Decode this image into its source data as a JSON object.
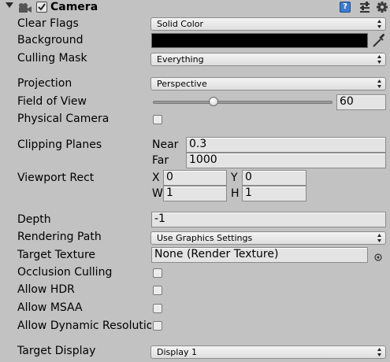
{
  "header": {
    "title": "Camera",
    "enabled": true,
    "help_glyph": "?",
    "icons": [
      "foldout-arrow-icon",
      "camera-component-icon",
      "help-icon",
      "preset-icon",
      "gear-icon"
    ]
  },
  "fields": {
    "clear_flags": {
      "label": "Clear Flags",
      "value": "Solid Color"
    },
    "background": {
      "label": "Background",
      "color": "#000000"
    },
    "culling_mask": {
      "label": "Culling Mask",
      "value": "Everything"
    },
    "projection": {
      "label": "Projection",
      "value": "Perspective"
    },
    "field_of_view": {
      "label": "Field of View",
      "value": "60"
    },
    "physical_camera": {
      "label": "Physical Camera",
      "checked": false
    },
    "clipping_planes": {
      "label": "Clipping Planes",
      "near_label": "Near",
      "near": "0.3",
      "far_label": "Far",
      "far": "1000"
    },
    "viewport_rect": {
      "label": "Viewport Rect",
      "x_label": "X",
      "x": "0",
      "y_label": "Y",
      "y": "0",
      "w_label": "W",
      "w": "1",
      "h_label": "H",
      "h": "1"
    },
    "depth": {
      "label": "Depth",
      "value": "-1"
    },
    "rendering_path": {
      "label": "Rendering Path",
      "value": "Use Graphics Settings"
    },
    "target_texture": {
      "label": "Target Texture",
      "value": "None (Render Texture)"
    },
    "occlusion_culling": {
      "label": "Occlusion Culling",
      "checked": false
    },
    "allow_hdr": {
      "label": "Allow HDR",
      "checked": false
    },
    "allow_msaa": {
      "label": "Allow MSAA",
      "checked": false
    },
    "allow_dynamic_resolution": {
      "label": "Allow Dynamic Resolutio",
      "checked": false
    },
    "target_display": {
      "label": "Target Display",
      "value": "Display 1"
    }
  },
  "colors": {
    "background": "#c2c2c2",
    "help_icon": "#3b7bd0"
  }
}
